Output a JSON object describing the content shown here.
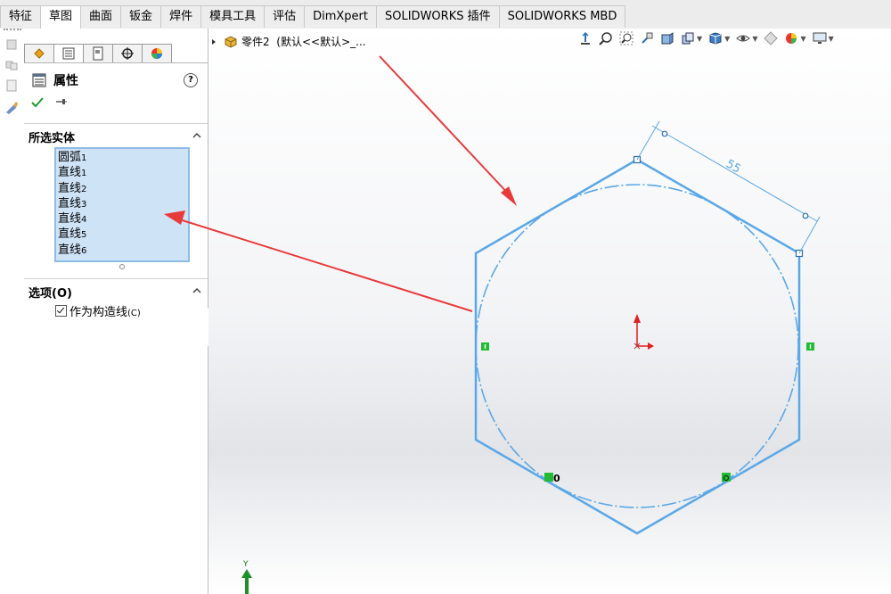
{
  "tabs": [
    {
      "label": "特征",
      "active": false
    },
    {
      "label": "草图",
      "active": true
    },
    {
      "label": "曲面",
      "active": false
    },
    {
      "label": "钣金",
      "active": false
    },
    {
      "label": "焊件",
      "active": false
    },
    {
      "label": "模具工具",
      "active": false
    },
    {
      "label": "评估",
      "active": false
    },
    {
      "label": "DimXpert",
      "active": false
    },
    {
      "label": "SOLIDWORKS 插件",
      "active": false
    },
    {
      "label": "SOLIDWORKS MBD",
      "active": false
    }
  ],
  "property_manager": {
    "tab_icons": [
      "feature-manager-icon",
      "property-manager-icon",
      "configuration-manager-icon",
      "dimxpert-manager-icon",
      "display-manager-icon"
    ],
    "title": "属性",
    "selected_entities": {
      "heading": "所选实体",
      "items": [
        {
          "name": "圆弧",
          "index": "1"
        },
        {
          "name": "直线",
          "index": "1"
        },
        {
          "name": "直线",
          "index": "2"
        },
        {
          "name": "直线",
          "index": "3"
        },
        {
          "name": "直线",
          "index": "4"
        },
        {
          "name": "直线",
          "index": "5"
        },
        {
          "name": "直线",
          "index": "6"
        }
      ]
    },
    "options": {
      "heading": "选项(O)",
      "construction_label": "作为构造线",
      "construction_shortcut": "(C)",
      "construction_checked": true
    }
  },
  "tree": {
    "part_label": "零件2",
    "config_label": "(默认<<默认>_..."
  },
  "sketch": {
    "dimension_value": "55",
    "relation_label": "0",
    "triad_y_label": "Y",
    "line_color": "#5aa7e8",
    "annotation_color": "#e8393b",
    "relation_color": "#22bb33"
  },
  "colors": {
    "accent_blue": "#5aa7e8",
    "selection_fill": "#cfe3f7",
    "arrow_red": "#e8393b"
  }
}
